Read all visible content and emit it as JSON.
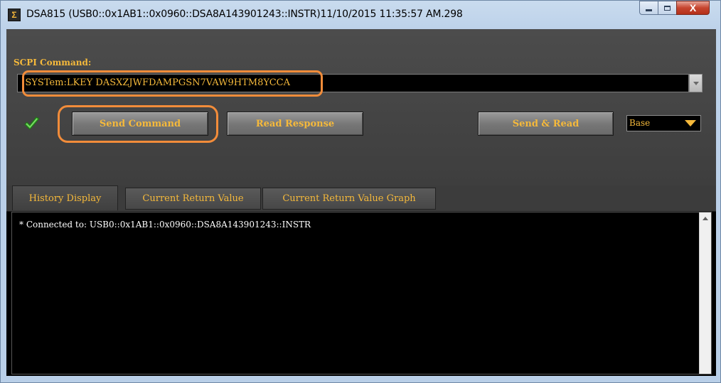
{
  "window": {
    "title": "DSA815 (USB0::0x1AB1::0x0960::DSA8A143901243::INSTR)11/10/2015 11:35:57 AM.298",
    "app_icon": "sigma-icon",
    "app_icon_glyph": "Σ",
    "controls": {
      "minimize": "minimize-icon",
      "maximize": "maximize-icon",
      "close": "close-icon",
      "close_glyph": "X"
    }
  },
  "scpi": {
    "label": "SCPI Command:",
    "command_value": ":SYSTem:LKEY DASXZJWFDAMPGSN7VAW9HTM8YCCA"
  },
  "status": {
    "icon": "checkmark-icon",
    "color": "#3fb22f"
  },
  "buttons": {
    "send_command": "Send Command",
    "read_response": "Read Response",
    "send_and_read": "Send & Read"
  },
  "mode_select": {
    "value": "Base"
  },
  "tabs": [
    {
      "label": "History Display",
      "active": true
    },
    {
      "label": "Current Return Value",
      "active": false
    },
    {
      "label": "Current Return Value Graph",
      "active": false
    }
  ],
  "history": {
    "lines": [
      "* Connected to: USB0::0x1AB1::0x0960::DSA8A143901243::INSTR"
    ]
  },
  "colors": {
    "accent_text": "#f5b93b",
    "highlight_annotation": "#f28c3a",
    "panel_bg": "#444444",
    "console_bg": "#000000"
  }
}
